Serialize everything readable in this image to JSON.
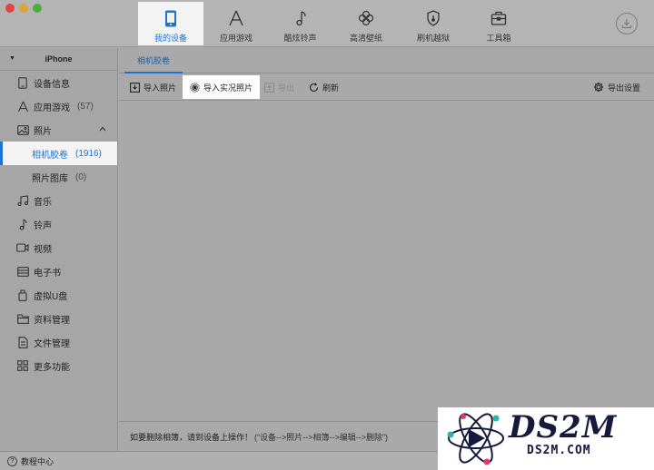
{
  "window": {
    "traffic_lights": [
      "close",
      "minimize",
      "zoom"
    ]
  },
  "nav": {
    "tabs": [
      {
        "label": "我的设备",
        "icon": "phone-icon",
        "active": true
      },
      {
        "label": "应用游戏",
        "icon": "app-store-icon",
        "active": false
      },
      {
        "label": "酷炫铃声",
        "icon": "music-note-icon",
        "active": false
      },
      {
        "label": "高清壁纸",
        "icon": "clover-icon",
        "active": false
      },
      {
        "label": "刷机越狱",
        "icon": "shield-icon",
        "active": false
      },
      {
        "label": "工具箱",
        "icon": "toolbox-icon",
        "active": false
      }
    ],
    "download_icon": "download-icon"
  },
  "sidebar": {
    "device_name": "iPhone",
    "items": [
      {
        "label": "设备信息",
        "icon": "device-info-icon",
        "count": ""
      },
      {
        "label": "应用游戏",
        "icon": "apps-icon",
        "count": "(57)"
      },
      {
        "label": "照片",
        "icon": "photo-icon",
        "count": "",
        "expanded": true
      },
      {
        "label": "相机胶卷",
        "icon": "",
        "count": "(1916)",
        "active": true
      },
      {
        "label": "照片图库",
        "icon": "",
        "count": "(0)"
      },
      {
        "label": "音乐",
        "icon": "music-icon",
        "count": ""
      },
      {
        "label": "铃声",
        "icon": "ringtone-icon",
        "count": ""
      },
      {
        "label": "视频",
        "icon": "video-icon",
        "count": ""
      },
      {
        "label": "电子书",
        "icon": "ebook-icon",
        "count": ""
      },
      {
        "label": "虚拟U盘",
        "icon": "usb-disk-icon",
        "count": ""
      },
      {
        "label": "资料管理",
        "icon": "folder-icon",
        "count": ""
      },
      {
        "label": "文件管理",
        "icon": "file-icon",
        "count": ""
      },
      {
        "label": "更多功能",
        "icon": "grid-icon",
        "count": ""
      }
    ]
  },
  "main": {
    "subtab": "相机胶卷",
    "toolbar": {
      "import_photos": "导入照片",
      "import_live_photos": "导入实况照片",
      "export": "导出",
      "refresh": "刷新",
      "export_settings": "导出设置"
    },
    "footer": {
      "prefix": "如要删除相簿，请到设备上操作！",
      "hint": "(“设备-->照片-->相簿-->编辑-->删除”)"
    }
  },
  "bottom": {
    "help_label": "教程中心"
  },
  "watermark": {
    "brand": "DS2M",
    "domain": "DS2M.COM"
  }
}
